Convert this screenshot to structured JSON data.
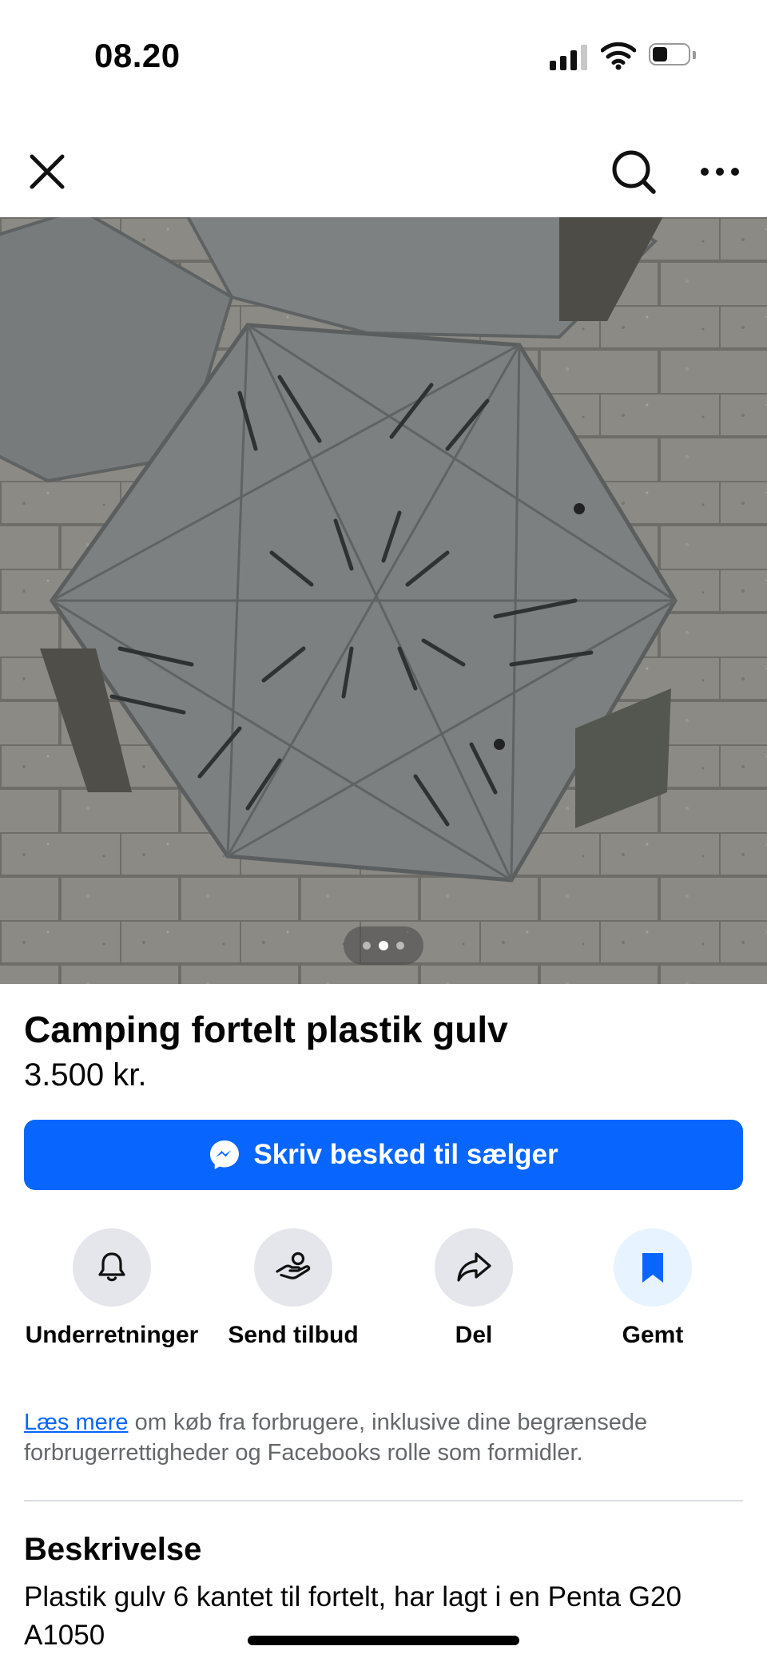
{
  "status_bar": {
    "time": "08.20",
    "icons": [
      "cellular-signal-icon",
      "wifi-icon",
      "battery-icon"
    ]
  },
  "nav": {
    "icons": [
      "close-icon",
      "search-icon",
      "more-icon"
    ]
  },
  "photo": {
    "alt_icon": "listing-photo",
    "pager_total": 3,
    "pager_active": 2
  },
  "listing": {
    "title": "Camping fortelt plastik gulv",
    "price": "3.500 kr."
  },
  "message_button": {
    "label": "Skriv besked til sælger",
    "icon": "messenger-icon"
  },
  "actions": [
    {
      "label": "Underretninger",
      "icon": "bell-icon"
    },
    {
      "label": "Send tilbud",
      "icon": "offer-hand-icon"
    },
    {
      "label": "Del",
      "icon": "share-icon"
    },
    {
      "label": "Gemt",
      "icon": "bookmark-icon"
    }
  ],
  "info": {
    "link": "Læs mere",
    "text": " om køb fra forbrugere, inklusive dine begrænsede forbrugerrettigheder og Facebooks rolle som formidler."
  },
  "description": {
    "heading": "Beskrivelse",
    "body": "Plastik gulv 6 kantet til fortelt, har lagt i en Penta G20 A1050"
  },
  "colors": {
    "accent": "#0866ff",
    "secondary_text": "#65676b",
    "icon_bg": "#e4e6eb"
  }
}
